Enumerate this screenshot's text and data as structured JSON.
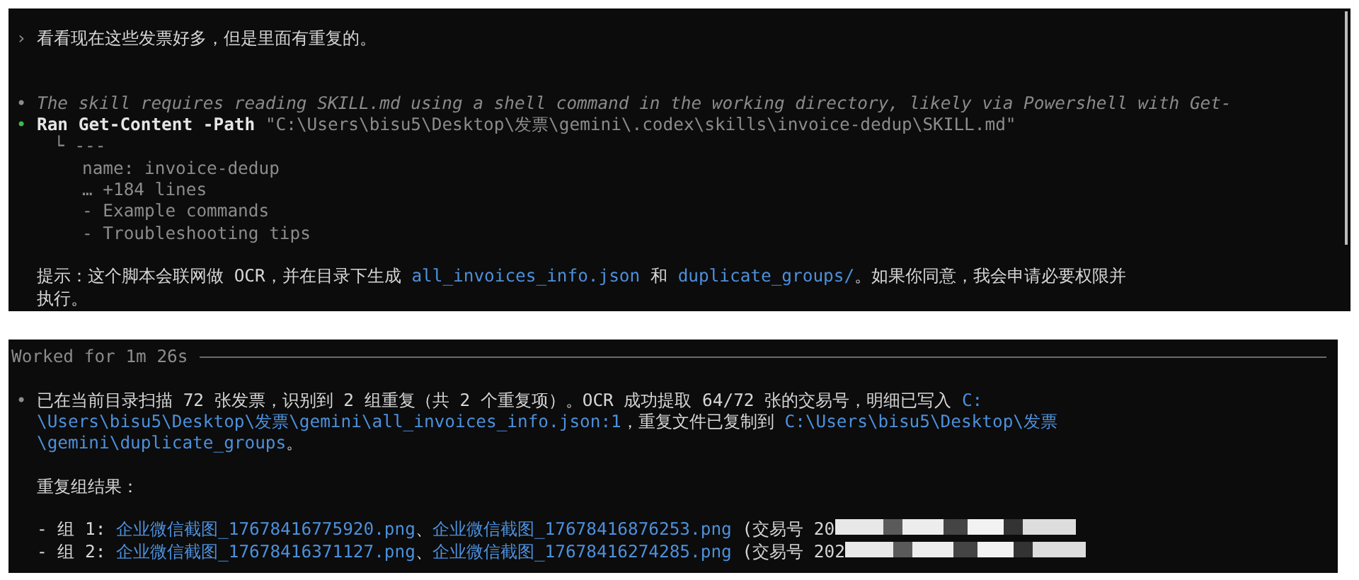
{
  "top_panel": {
    "prompt_symbol": "›",
    "user_message": "看看现在这些发票好多，但是里面有重复的。",
    "reasoning": {
      "bullet": "•",
      "text": "The skill requires reading SKILL.md using a shell command in the working directory, likely via Powershell with Get-"
    },
    "command": {
      "bullet": "•",
      "verb": "Ran",
      "text": "Get-Content -Path",
      "argument": "\"C:\\Users\\bisu5\\Desktop\\发票\\gemini\\.codex\\skills\\invoice-dedup\\SKILL.md\""
    },
    "output": {
      "branch": "└",
      "lines": [
        "---",
        "name: invoice-dedup",
        "… +184 lines",
        "- Example commands",
        "- Troubleshooting tips"
      ]
    },
    "note": [
      [
        {
          "kind": "text",
          "text": "提示：这个脚本会联网做 OCR，并在目录下生成 "
        },
        {
          "kind": "link",
          "text": "all_invoices_info.json"
        },
        {
          "kind": "text",
          "text": " 和 "
        },
        {
          "kind": "link",
          "text": "duplicate_groups/"
        },
        {
          "kind": "text",
          "text": "。如果你同意，我会申请必要权限并"
        }
      ],
      [
        {
          "kind": "text",
          "text": "执行。"
        }
      ]
    ]
  },
  "bottom_panel": {
    "divider_label": "Worked for 1m 26s",
    "bullet": "•",
    "summary": [
      [
        {
          "kind": "text",
          "text": "已在当前目录扫描 72 张发票，识别到 2 组重复（共 2 个重复项）。OCR 成功提取 64/72 张的交易号，明细已写入 "
        },
        {
          "kind": "link",
          "text": "C:"
        }
      ],
      [
        {
          "kind": "link",
          "text": "\\Users\\bisu5\\Desktop\\发票\\gemini\\all_invoices_info.json:1"
        },
        {
          "kind": "text",
          "text": "，重复文件已复制到 "
        },
        {
          "kind": "link",
          "text": "C:\\Users\\bisu5\\Desktop\\发票"
        }
      ],
      [
        {
          "kind": "link",
          "text": "\\gemini\\duplicate_groups"
        },
        {
          "kind": "text",
          "text": "。"
        }
      ]
    ],
    "heading": "重复组结果：",
    "groups": [
      {
        "label": "- 组 1:",
        "files": [
          "企业微信截图_17678416775920.png",
          "企业微信截图_17678416876253.png"
        ],
        "separator": "、",
        "transaction": "(交易号 20"
      },
      {
        "label": "- 组 2:",
        "files": [
          "企业微信截图_17678416371127.png",
          "企业微信截图_17678416274285.png"
        ],
        "separator": "、",
        "transaction": "(交易号 202"
      }
    ]
  }
}
